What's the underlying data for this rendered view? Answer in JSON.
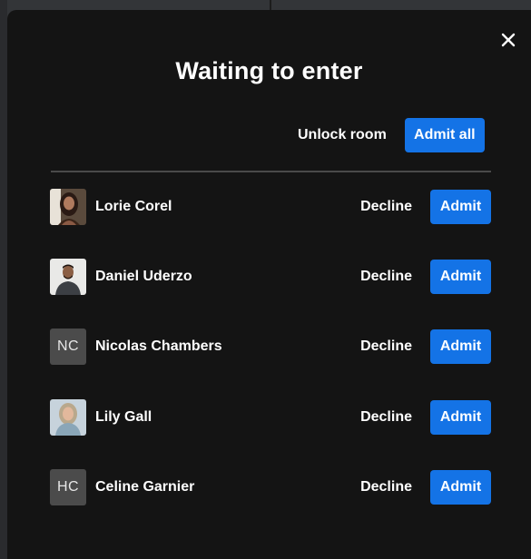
{
  "dialog": {
    "title": "Waiting to enter",
    "unlock_label": "Unlock room",
    "admit_all_label": "Admit all",
    "close_icon": "close-icon"
  },
  "participants": [
    {
      "name": "Lorie Corel",
      "avatar": "photo",
      "initials": "",
      "decline_label": "Decline",
      "admit_label": "Admit"
    },
    {
      "name": "Daniel Uderzo",
      "avatar": "photo",
      "initials": "",
      "decline_label": "Decline",
      "admit_label": "Admit"
    },
    {
      "name": "Nicolas Chambers",
      "avatar": "initials",
      "initials": "NC",
      "decline_label": "Decline",
      "admit_label": "Admit"
    },
    {
      "name": "Lily Gall",
      "avatar": "photo",
      "initials": "",
      "decline_label": "Decline",
      "admit_label": "Admit"
    },
    {
      "name": "Celine Garnier",
      "avatar": "initials",
      "initials": "HC",
      "decline_label": "Decline",
      "admit_label": "Admit"
    }
  ],
  "colors": {
    "accent": "#1473e6",
    "background": "#141414",
    "text": "#ffffff",
    "initials_bg": "#4b4b4b"
  }
}
